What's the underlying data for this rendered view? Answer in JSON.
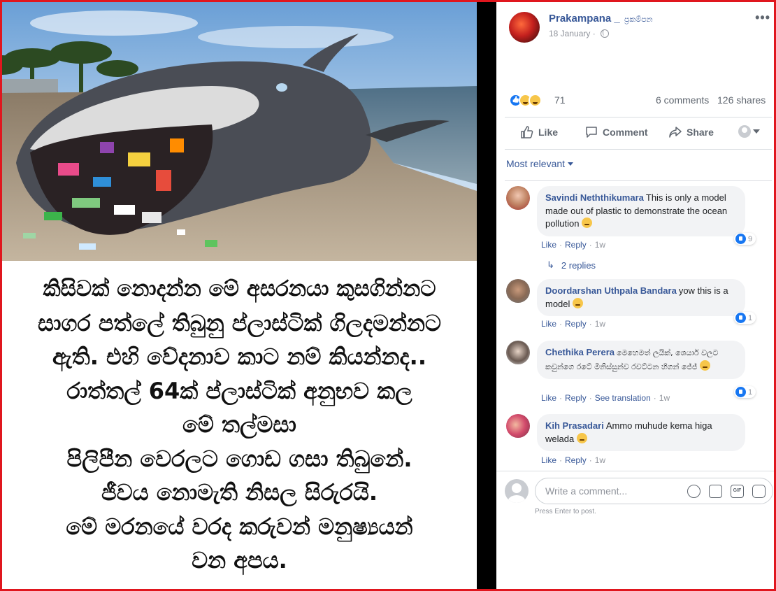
{
  "post_image": {
    "caption_lines": [
      "කිසිවක් නොදන්න මේ අසරනයා කුසගින්නට",
      "සාගර පත්ලේ තිබුනු ප්ලාස්ටික් ගිලදමන්නට",
      "ඇති. එහි වේදනාව කාට නම් කියන්නද..",
      "රාත්තල් 64ක් ප්ලාස්ටික් අනුභව කල",
      "මේ තල්මසා",
      "පිලිපීන වෙරලට ගොඩ ගසා තිබුනේ.",
      "ජීවය නොමැති නිසල සිරුරයි.",
      "මේ මරනයේ වරද කරුවන් මනුෂ්‍යයන්",
      "වන අපය."
    ]
  },
  "post": {
    "page_name": "Prakampana _",
    "page_name_sub": "ප්‍රකම්පන",
    "date": "18 January",
    "more_icon": "more-options-icon",
    "reaction_count": "71",
    "comments_count": "6 comments",
    "shares_count": "126 shares"
  },
  "actions": {
    "like": "Like",
    "comment": "Comment",
    "share": "Share"
  },
  "filter_label": "Most relevant",
  "comments": [
    {
      "author": "Savindi Neththikumara",
      "text": "This is only a model made out of plastic to demonstrate the ocean pollution",
      "likes": "9",
      "like": "Like",
      "reply": "Reply",
      "time": "1w"
    },
    {
      "author": "Doordarshan Uthpala Bandara",
      "text": "yow this is a model",
      "likes": "1",
      "like": "Like",
      "reply": "Reply",
      "time": "1w"
    },
    {
      "author": "Chethika Perera",
      "text": "මෙහෙමත් ලයික්, ශෙයාර් වලට කවුන්ගෙ රටේ මිනිස්සුන්ව රවට්ටන හිගන් ජේජ්",
      "likes": "1",
      "like": "Like",
      "reply": "Reply",
      "translate": "See translation",
      "time": "1w"
    },
    {
      "author": "Kih Prasadari",
      "text": "Ammo muhude kema higa welada",
      "like": "Like",
      "reply": "Reply",
      "time": "1w"
    }
  ],
  "replies_link": "2 replies",
  "composer": {
    "placeholder": "Write a comment...",
    "hint": "Press Enter to post."
  },
  "colors": {
    "frame": "#e0161e",
    "link_blue": "#385898",
    "like_blue": "#1877f2"
  }
}
